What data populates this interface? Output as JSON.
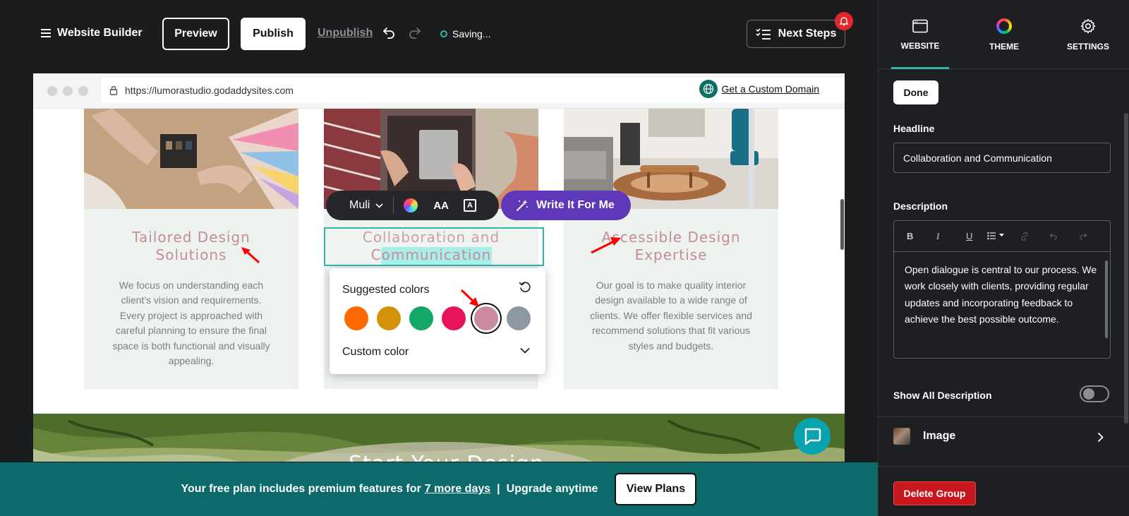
{
  "topbar": {
    "app_title": "Website Builder",
    "preview_label": "Preview",
    "publish_label": "Publish",
    "unpublish_label": "Unpublish",
    "status": "Saving...",
    "next_steps_label": "Next Steps"
  },
  "browser": {
    "url": "https://lumorastudio.godaddysites.com",
    "custom_domain_label": "Get a Custom Domain"
  },
  "cards": [
    {
      "title_line1": "Tailored Design",
      "title_line2": "Solutions",
      "description": "We focus on understanding each client's vision and requirements. Every project is approached with careful planning to ensure the final space is both functional and visually appealing."
    },
    {
      "title_line1": "Collaboration and",
      "title_line2": "Communication",
      "description": ""
    },
    {
      "title_line1": "Accessible Design",
      "title_line2": "Expertise",
      "description": "Our goal is to make quality interior design available to a wide range of clients. We offer flexible services and recommend solutions that fit various styles and budgets."
    }
  ],
  "next_section_title": "Start Your Design",
  "text_toolbar": {
    "font_name": "Muli",
    "text_size_icon": "AA",
    "write_label": "Write It For Me"
  },
  "color_picker": {
    "title": "Suggested colors",
    "custom_label": "Custom color",
    "swatches": [
      "#ff6a00",
      "#d4920b",
      "#14a765",
      "#e8145a",
      "#c98aa0",
      "#8d98a3"
    ],
    "selected_index": 4
  },
  "banner": {
    "text_before": "Your free plan includes premium features for",
    "link_text": "7 more days",
    "separator": "|",
    "text_after": "Upgrade anytime",
    "view_plans_label": "View Plans"
  },
  "panel": {
    "tabs": [
      {
        "label": "WEBSITE",
        "icon": "browser-window-icon"
      },
      {
        "label": "THEME",
        "icon": "theme-ring-icon"
      },
      {
        "label": "SETTINGS",
        "icon": "gear-icon"
      }
    ],
    "done_label": "Done",
    "headline_label": "Headline",
    "headline_value": "Collaboration and Communication",
    "description_label": "Description",
    "description_value": "Open dialogue is central to our process. We work closely with clients, providing regular updates and incorporating feedback to achieve the best possible outcome.",
    "editor_tools": {
      "bold": "B",
      "italic": "I",
      "underline": "U"
    },
    "show_all_label": "Show All Description",
    "show_all_on": false,
    "image_label": "Image",
    "delete_label": "Delete Group"
  },
  "colors": {
    "accent": "#2fb8a9",
    "banner": "#0c6b6a",
    "heading_pink": "#c48d9a",
    "write_purple": "#5e38b9",
    "danger": "#c8171f"
  }
}
